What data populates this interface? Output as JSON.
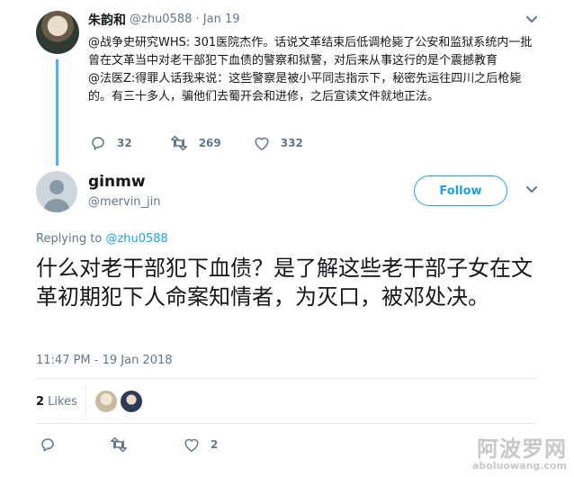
{
  "parent_tweet": {
    "name": "朱韵和",
    "handle": "@zhu0588",
    "date": "· Jan 19",
    "body_line1": "@战争史研究WHS:  301医院杰作。话说文革结束后低调枪毙了公安和监狱系统内一批曾在文革当中对老干部犯下血债的警察和狱警，对后来从事这行的是个震撼教育",
    "body_line2": " @法医Z:得罪人话我来说：这些警察是被小平同志指示下，秘密先运往四川之后枪毙的。有三十多人，骗他们去蜀开会和进修，之后宣读文件就地正法。",
    "reply_count": "32",
    "retweet_count": "269",
    "like_count": "332",
    "icons": [
      "reply-icon",
      "retweet-icon",
      "heart-icon",
      "chevron-down-icon"
    ]
  },
  "main_tweet": {
    "name": "ginmw",
    "handle": "@mervin_jin",
    "follow_label": "Follow",
    "replying_prefix": "Replying to ",
    "replying_to": "@zhu0588",
    "body": "什么对老干部犯下血债？是了解这些老干部子女在文革初期犯下人命案知情者，为灭口，被邓处决。",
    "timestamp": "11:47 PM - 19 Jan 2018",
    "likes_count": "2",
    "likes_label": " Likes",
    "like_action_count": "2"
  },
  "colors": {
    "accent": "#1da1f2",
    "thread_line": "#4ab3f4",
    "muted_text": "#657786",
    "border": "#e6ecf0"
  },
  "watermark": {
    "big": "阿波罗网",
    "small": "aboluowang.com"
  }
}
